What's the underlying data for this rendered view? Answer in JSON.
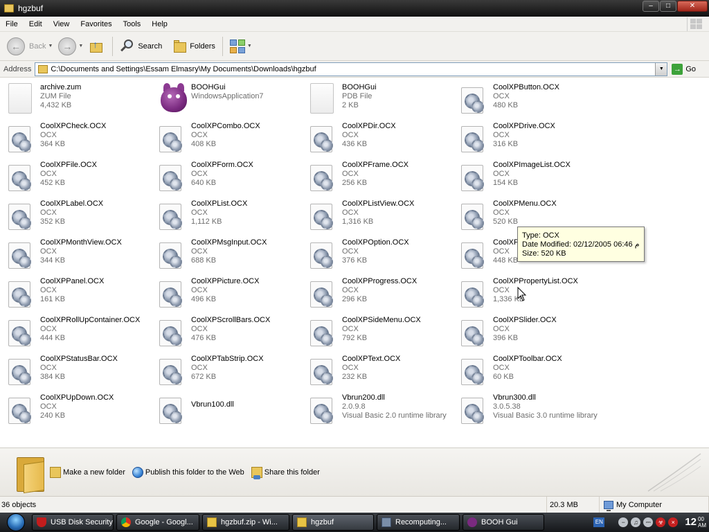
{
  "window": {
    "title": "hgzbuf",
    "controls": {
      "minimize": "–",
      "maximize": "□",
      "close": "✕"
    }
  },
  "menu": [
    "File",
    "Edit",
    "View",
    "Favorites",
    "Tools",
    "Help"
  ],
  "toolbar": {
    "back_label": "Back",
    "search_label": "Search",
    "folders_label": "Folders"
  },
  "address": {
    "label": "Address",
    "path": "C:\\Documents and Settings\\Essam Elmasry\\My Documents\\Downloads\\hgzbuf",
    "go_label": "Go"
  },
  "files": [
    {
      "name": "archive.zum",
      "type": "ZUM File",
      "size": "4,432 KB",
      "icon": "blank-file-icon"
    },
    {
      "name": "BOOHGui",
      "type": "WindowsApplication7",
      "size": "",
      "icon": "booh-app-icon"
    },
    {
      "name": "BOOHGui",
      "type": "PDB File",
      "size": "2 KB",
      "icon": "blank-file-icon"
    },
    {
      "name": "CoolXPButton.OCX",
      "type": "OCX",
      "size": "480 KB",
      "icon": "ocx-file-icon"
    },
    {
      "name": "CoolXPCheck.OCX",
      "type": "OCX",
      "size": "364 KB",
      "icon": "ocx-file-icon"
    },
    {
      "name": "CoolXPCombo.OCX",
      "type": "OCX",
      "size": "408 KB",
      "icon": "ocx-file-icon"
    },
    {
      "name": "CoolXPDir.OCX",
      "type": "OCX",
      "size": "436 KB",
      "icon": "ocx-file-icon"
    },
    {
      "name": "CoolXPDrive.OCX",
      "type": "OCX",
      "size": "316 KB",
      "icon": "ocx-file-icon"
    },
    {
      "name": "CoolXPFile.OCX",
      "type": "OCX",
      "size": "452 KB",
      "icon": "ocx-file-icon"
    },
    {
      "name": "CoolXPForm.OCX",
      "type": "OCX",
      "size": "640 KB",
      "icon": "ocx-file-icon"
    },
    {
      "name": "CoolXPFrame.OCX",
      "type": "OCX",
      "size": "256 KB",
      "icon": "ocx-file-icon"
    },
    {
      "name": "CoolXPImageList.OCX",
      "type": "OCX",
      "size": "154 KB",
      "icon": "ocx-file-icon"
    },
    {
      "name": "CoolXPLabel.OCX",
      "type": "OCX",
      "size": "352 KB",
      "icon": "ocx-file-icon"
    },
    {
      "name": "CoolXPList.OCX",
      "type": "OCX",
      "size": "1,112 KB",
      "icon": "ocx-file-icon"
    },
    {
      "name": "CoolXPListView.OCX",
      "type": "OCX",
      "size": "1,316 KB",
      "icon": "ocx-file-icon"
    },
    {
      "name": "CoolXPMenu.OCX",
      "type": "OCX",
      "size": "520 KB",
      "icon": "ocx-file-icon"
    },
    {
      "name": "CoolXPMonthView.OCX",
      "type": "OCX",
      "size": "344 KB",
      "icon": "ocx-file-icon"
    },
    {
      "name": "CoolXPMsgInput.OCX",
      "type": "OCX",
      "size": "688 KB",
      "icon": "ocx-file-icon"
    },
    {
      "name": "CoolXPOption.OCX",
      "type": "OCX",
      "size": "376 KB",
      "icon": "ocx-file-icon"
    },
    {
      "name": "CoolXPO",
      "type": "OCX",
      "size": "448 KB",
      "icon": "ocx-file-icon"
    },
    {
      "name": "CoolXPPanel.OCX",
      "type": "OCX",
      "size": "161 KB",
      "icon": "ocx-file-icon"
    },
    {
      "name": "CoolXPPicture.OCX",
      "type": "OCX",
      "size": "496 KB",
      "icon": "ocx-file-icon"
    },
    {
      "name": "CoolXPProgress.OCX",
      "type": "OCX",
      "size": "296 KB",
      "icon": "ocx-file-icon"
    },
    {
      "name": "CoolXPPropertyList.OCX",
      "type": "OCX",
      "size": "1,336 KB",
      "icon": "ocx-file-icon"
    },
    {
      "name": "CoolXPRollUpContainer.OCX",
      "type": "OCX",
      "size": "444 KB",
      "icon": "ocx-file-icon"
    },
    {
      "name": "CoolXPScrollBars.OCX",
      "type": "OCX",
      "size": "476 KB",
      "icon": "ocx-file-icon"
    },
    {
      "name": "CoolXPSideMenu.OCX",
      "type": "OCX",
      "size": "792 KB",
      "icon": "ocx-file-icon"
    },
    {
      "name": "CoolXPSlider.OCX",
      "type": "OCX",
      "size": "396 KB",
      "icon": "ocx-file-icon"
    },
    {
      "name": "CoolXPStatusBar.OCX",
      "type": "OCX",
      "size": "384 KB",
      "icon": "ocx-file-icon"
    },
    {
      "name": "CoolXPTabStrip.OCX",
      "type": "OCX",
      "size": "672 KB",
      "icon": "ocx-file-icon"
    },
    {
      "name": "CoolXPText.OCX",
      "type": "OCX",
      "size": "232 KB",
      "icon": "ocx-file-icon"
    },
    {
      "name": "CoolXPToolbar.OCX",
      "type": "OCX",
      "size": "60 KB",
      "icon": "ocx-file-icon"
    },
    {
      "name": "CoolXPUpDown.OCX",
      "type": "OCX",
      "size": "240 KB",
      "icon": "ocx-file-icon"
    },
    {
      "name": "Vbrun100.dll",
      "type": "",
      "size": "",
      "icon": "dll-file-icon"
    },
    {
      "name": "Vbrun200.dll",
      "type": "2.0.9.8",
      "size": "Visual Basic 2.0 runtime library",
      "icon": "dll-file-icon"
    },
    {
      "name": "Vbrun300.dll",
      "type": "3.0.5.38",
      "size": "Visual Basic 3.0 runtime library",
      "icon": "dll-file-icon"
    }
  ],
  "tooltip": {
    "type": "Type: OCX",
    "modified": "Date Modified: 02/12/2005 06:46 م",
    "size": "Size: 520 KB"
  },
  "tasks": {
    "new_folder": "Make a new folder",
    "publish": "Publish this folder to the Web",
    "share": "Share this folder"
  },
  "status": {
    "objects": "36 objects",
    "size": "20.3 MB",
    "location": "My Computer"
  },
  "taskbar": {
    "buttons": [
      {
        "label": "USB Disk Security",
        "icon": "shield-icon"
      },
      {
        "label": "Google - Googl...",
        "icon": "chrome-icon"
      },
      {
        "label": "hgzbuf.zip - Wi...",
        "icon": "zip-icon"
      },
      {
        "label": "hgzbuf",
        "icon": "folder-icon"
      },
      {
        "label": "Recomputing...",
        "icon": "app-icon"
      },
      {
        "label": "BOOH Gui",
        "icon": "booh-icon"
      }
    ],
    "lang": "EN",
    "clock_time": "12",
    "clock_min": "00",
    "clock_ampm": "AM"
  }
}
